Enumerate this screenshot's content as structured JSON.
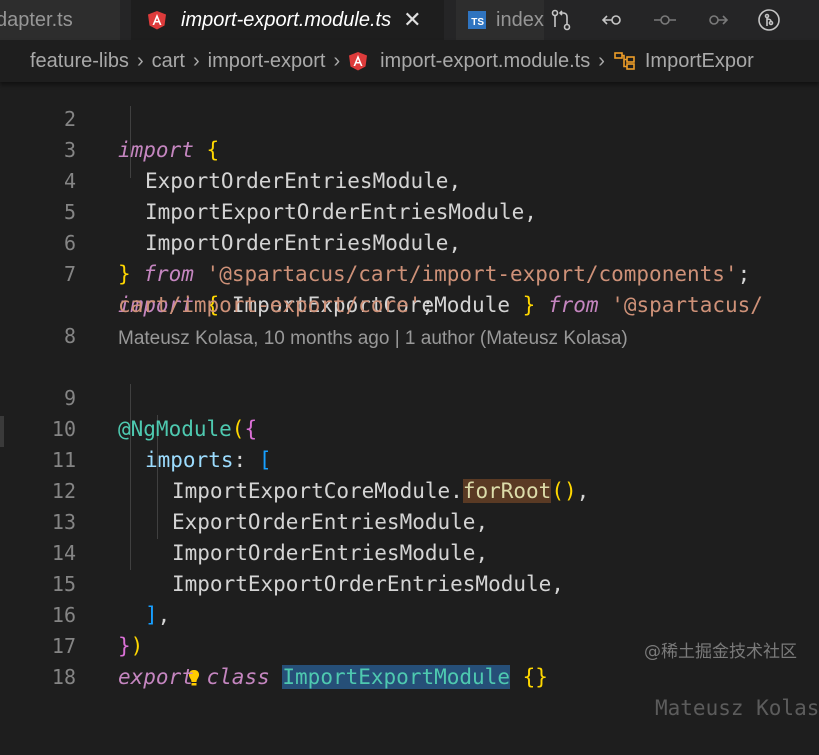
{
  "tabs": [
    {
      "label": "dapter.ts"
    },
    {
      "label": "import-export.module.ts",
      "active": true,
      "close": "✕"
    },
    {
      "label": "index",
      "badge": "TS"
    }
  ],
  "actions": [
    "source-control-icon",
    "go-back-icon",
    "git-commit-icon",
    "go-forward-icon",
    "git-lens-icon"
  ],
  "breadcrumb": [
    "feature-libs",
    "cart",
    "import-export",
    "import-export.module.ts",
    "ImportExpor"
  ],
  "lines": {
    "l2": {
      "n": "2",
      "import": "import",
      "brace": "{"
    },
    "l3": {
      "n": "3",
      "text": "ExportOrderEntriesModule",
      "comma": ","
    },
    "l4": {
      "n": "4",
      "text": "ImportExportOrderEntriesModule",
      "comma": ","
    },
    "l5": {
      "n": "5",
      "text": "ImportOrderEntriesModule",
      "comma": ","
    },
    "l6": {
      "n": "6",
      "brace": "}",
      "from": "from",
      "str": "'@spartacus/cart/import-export/components'",
      "semi": ";"
    },
    "l7": {
      "n": "7",
      "import": "import",
      "open": "{",
      "name": "ImportExportCoreModule",
      "close": "}",
      "from": "from",
      "str1": "'@spartacus/"
    },
    "l7b": {
      "str2": "cart/import-export/core'",
      "semi": ";"
    },
    "l8": {
      "n": "8"
    },
    "lens": "Mateusz Kolasa, 10 months ago | 1 author (Mateusz Kolasa)",
    "l9": {
      "n": "9",
      "dec": "@NgModule",
      "paren": "(",
      "brace": "{"
    },
    "l10": {
      "n": "10",
      "prop": "imports",
      "colon": ":",
      "bracket": "["
    },
    "l11": {
      "n": "11",
      "cls": "ImportExportCoreModule",
      "dot": ".",
      "fn": "forRoot",
      "parens": "()",
      "comma": ","
    },
    "l12": {
      "n": "12",
      "text": "ExportOrderEntriesModule",
      "comma": ","
    },
    "l13": {
      "n": "13",
      "text": "ImportOrderEntriesModule",
      "comma": ","
    },
    "l14": {
      "n": "14",
      "text": "ImportExportOrderEntriesModule",
      "comma": ","
    },
    "l15": {
      "n": "15",
      "bracket": "]",
      "comma": ","
    },
    "l16": {
      "n": "16",
      "brace": "}",
      "paren": ")"
    },
    "l17": {
      "n": "17",
      "export": "export",
      "class": "class",
      "name": "ImportExportModule",
      "body": "{}",
      "blame": "Mateusz Kolas"
    },
    "l18": {
      "n": "18"
    }
  },
  "watermark": "@稀土掘金技术社区",
  "colors": {
    "keyword": "#c586c0",
    "string": "#ce9178",
    "type": "#4ec9b0",
    "function": "#dcdcaa",
    "property": "#9cdcfe",
    "background": "#1e1e1e"
  }
}
